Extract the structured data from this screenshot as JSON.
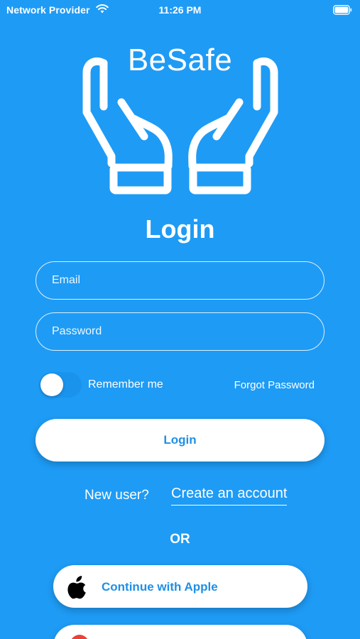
{
  "status_bar": {
    "carrier": "Network Provider",
    "time": "11:26 PM"
  },
  "brand": {
    "name": "BeSafe"
  },
  "login": {
    "title": "Login",
    "email_placeholder": "Email",
    "password_placeholder": "Password",
    "remember_label": "Remember me",
    "remember_on": false,
    "forgot_label": "Forgot Password",
    "login_button_label": "Login",
    "new_user_label": "New user?",
    "create_account_label": "Create an account",
    "or_label": "OR"
  },
  "social": {
    "apple_label": "Continue with Apple"
  },
  "colors": {
    "background": "#1E9BF5",
    "accent_text": "#1E90E6",
    "button_bg": "#FFFFFF",
    "google_red": "#EA4335"
  }
}
